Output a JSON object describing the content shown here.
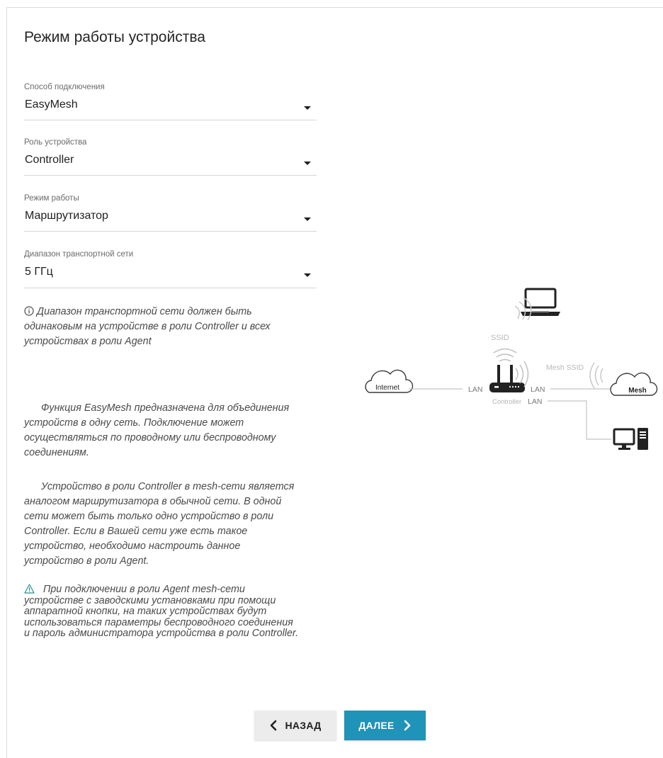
{
  "page": {
    "title": "Режим работы устройства"
  },
  "fields": {
    "connection_method": {
      "label": "Способ подключения",
      "value": "EasyMesh"
    },
    "device_role": {
      "label": "Роль устройства",
      "value": "Controller"
    },
    "operation_mode": {
      "label": "Режим работы",
      "value": "Маршрутизатор"
    },
    "backhaul_band": {
      "label": "Диапазон транспортной сети",
      "value": "5 ГГц"
    }
  },
  "info": {
    "band_note_lines": [
      "Диапазон транспортной сети должен быть",
      "одинаковым на устройстве в роли Controller и всех",
      "устройствах в роли Agent"
    ],
    "easymesh_lines": [
      "Функция EasyMesh предназначена для объединения",
      "устройств в одну сеть. Подключение может",
      "осуществляться по проводному или беспроводному",
      "соединениям."
    ],
    "controller_lines": [
      "Устройство в роли Controller в mesh-сети является",
      "аналогом маршрутизатора в обычной сети. В одной",
      "сети может быть только одно устройство в роли",
      "Controller. Если в Вашей сети уже есть такое",
      "устройство, необходимо настроить данное",
      "устройство в роли Agent."
    ],
    "warning_lines": [
      "При подключении в роли Agent mesh-сети",
      "устройстве с заводскими установками при помощи",
      "аппаратной кнопки, на таких устройствах будут",
      "использоваться параметры беспроводного соединения",
      "и пароль администратора устройства в роли Controller."
    ]
  },
  "diagram": {
    "internet_label": "Internet",
    "mesh_label": "Mesh",
    "ssid_label": "SSID",
    "mesh_ssid_label": "Mesh SSID",
    "lan_left": "LAN",
    "lan_right_1": "LAN",
    "lan_right_2": "LAN",
    "controller_label": "Controller"
  },
  "buttons": {
    "back_label": "НАЗАД",
    "next_label": "ДАЛЕЕ"
  },
  "icons": [
    "info-icon",
    "warning-icon",
    "chevron-left-icon",
    "chevron-right-icon",
    "laptop-icon",
    "router-icon",
    "desktop-icon",
    "cloud-icon",
    "wifi-icon"
  ],
  "colors": {
    "accent": "#1f93b8",
    "secondary_button": "#ececec"
  }
}
